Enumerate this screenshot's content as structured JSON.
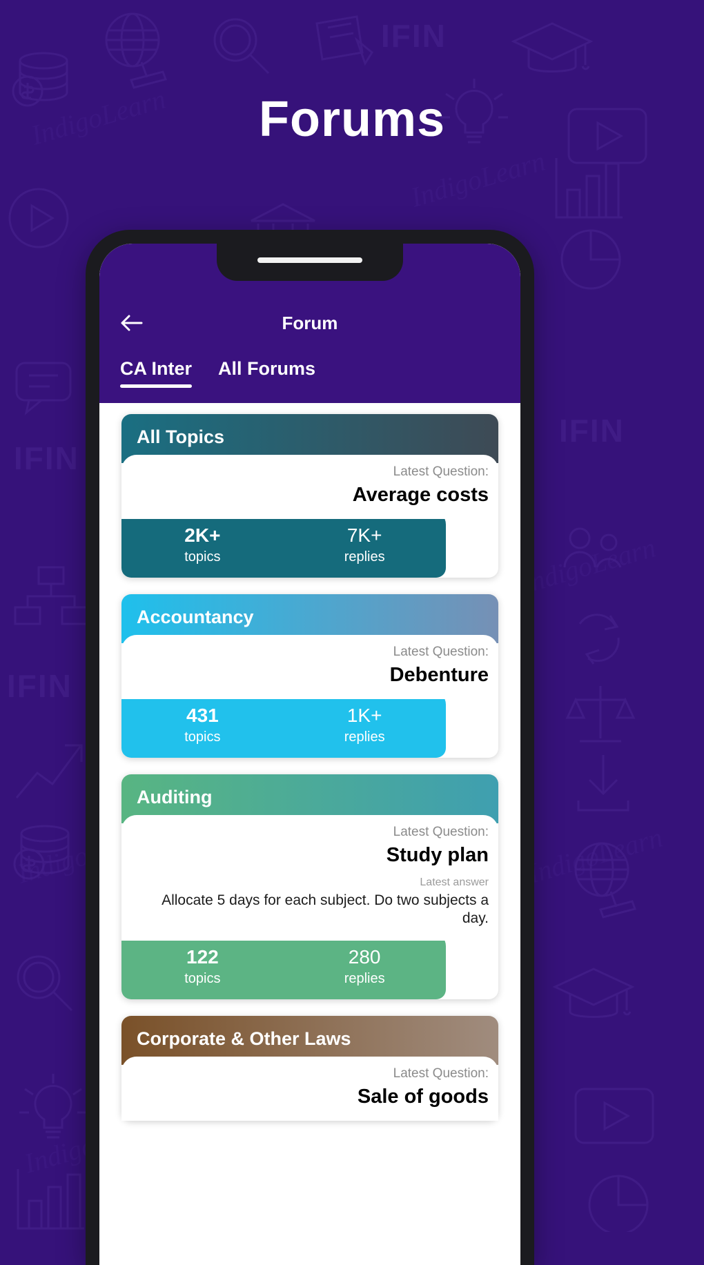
{
  "page": {
    "title": "Forums",
    "background_color": "#36112d",
    "watermark_text": "IndigoLearn",
    "brand_mark": "IFIN"
  },
  "app": {
    "back_icon": "arrow-left-icon",
    "title": "Forum",
    "header_color": "#3a127f",
    "tabs": [
      {
        "label": "CA Inter",
        "active": true
      },
      {
        "label": "All Forums",
        "active": false
      }
    ]
  },
  "labels": {
    "latest_question": "Latest Question:",
    "latest_answer": "Latest answer",
    "topics": "topics",
    "replies": "replies"
  },
  "cards": [
    {
      "title": "All Topics",
      "gradient_from": "#1a6f82",
      "gradient_to": "#3e4a55",
      "stats_color": "#156b7c",
      "latest_question": "Average costs",
      "latest_answer": "",
      "topics_value": "2K+",
      "replies_value": "7K+"
    },
    {
      "title": "Accountancy",
      "gradient_from": "#1fc0ec",
      "gradient_to": "#7690b5",
      "stats_color": "#21c1ec",
      "latest_question": "Debenture",
      "latest_answer": "",
      "topics_value": "431",
      "replies_value": "1K+"
    },
    {
      "title": "Auditing",
      "gradient_from": "#58b582",
      "gradient_to": "#3f9fb0",
      "stats_color": "#5cb484",
      "latest_question": "Study plan",
      "latest_answer": "Allocate 5 days for each subject. Do two subjects a day.",
      "topics_value": "122",
      "replies_value": "280"
    },
    {
      "title": "Corporate & Other Laws",
      "gradient_from": "#7a5129",
      "gradient_to": "#a08c7e",
      "stats_color": "#7a5129",
      "latest_question": "Sale of goods",
      "latest_answer": "",
      "topics_value": "",
      "replies_value": ""
    }
  ]
}
